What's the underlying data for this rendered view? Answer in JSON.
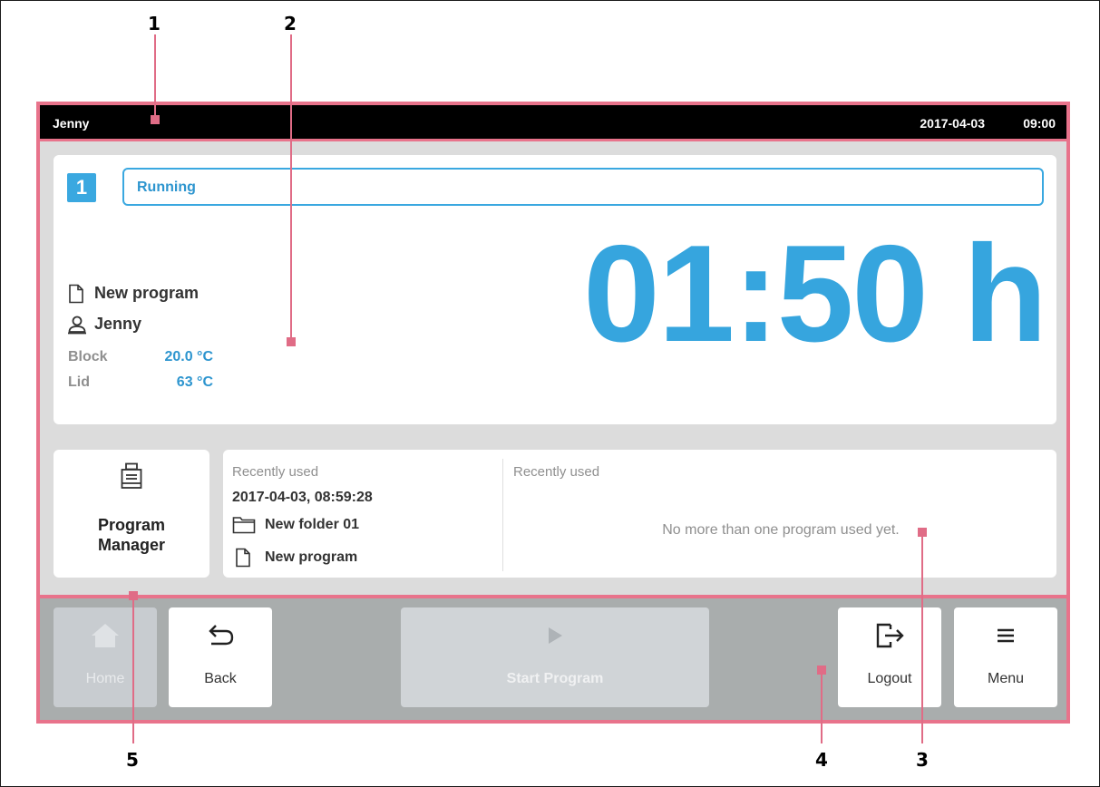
{
  "callouts": [
    "1",
    "2",
    "3",
    "4",
    "5"
  ],
  "statusbar": {
    "user": "Jenny",
    "date": "2017-04-03",
    "time": "09:00"
  },
  "run": {
    "slot": "1",
    "status": "Running",
    "timer": "01:50 h",
    "program": "New program",
    "user": "Jenny",
    "block_label": "Block",
    "block_value": "20.0 °C",
    "lid_label": "Lid",
    "lid_value": "63 °C"
  },
  "program_manager": {
    "label_line1": "Program",
    "label_line2": "Manager"
  },
  "recent": {
    "left_heading": "Recently used",
    "left_timestamp": "2017-04-03, 08:59:28",
    "left_folder": "New folder 01",
    "left_program": "New program",
    "right_heading": "Recently used",
    "right_message": "No more than one program used yet."
  },
  "nav": {
    "home": "Home",
    "back": "Back",
    "start": "Start Program",
    "logout": "Logout",
    "menu": "Menu"
  },
  "colors": {
    "accent": "#36a5de",
    "callout": "#e8738b",
    "status_bar": "#000000"
  },
  "icons": [
    "document-icon",
    "user-icon",
    "printer-icon",
    "folder-icon",
    "home-icon",
    "back-arrow-icon",
    "play-icon",
    "logout-icon",
    "menu-icon"
  ]
}
